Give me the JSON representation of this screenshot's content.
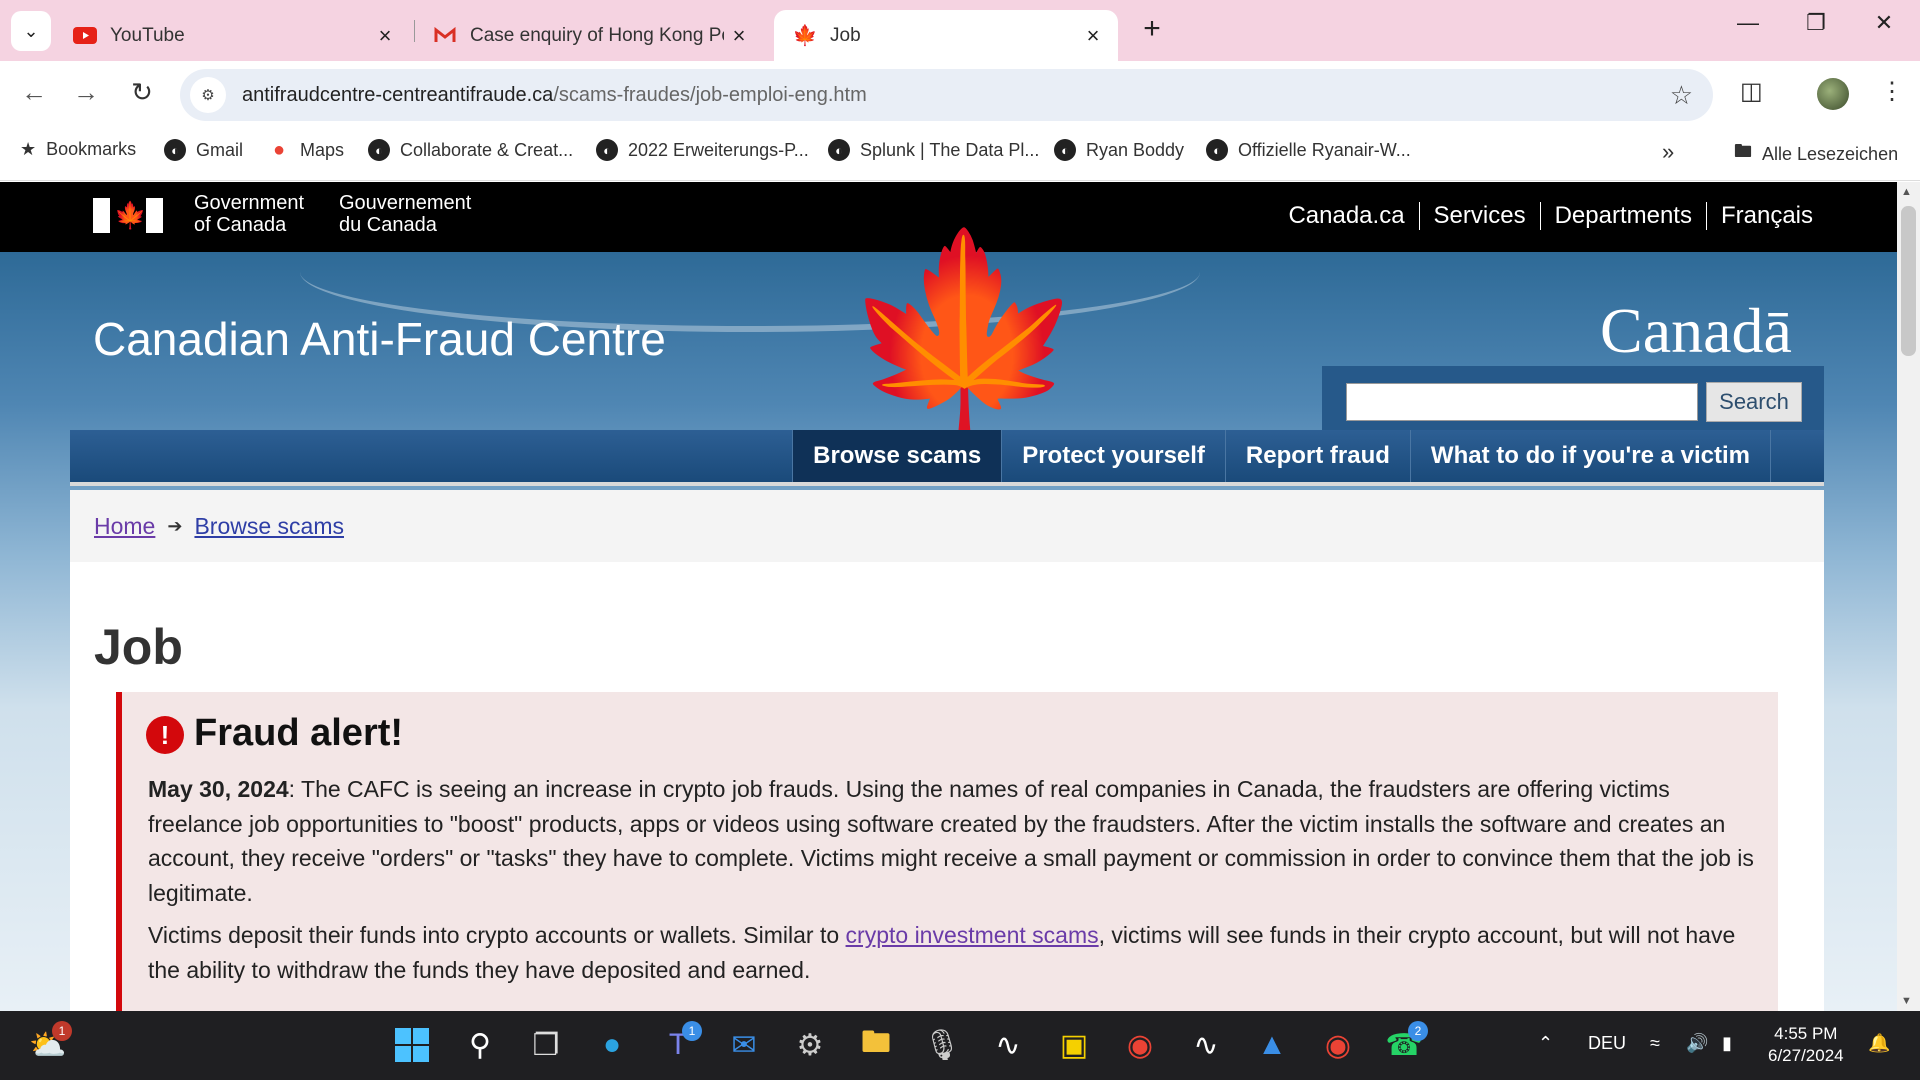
{
  "browser": {
    "tabs": [
      {
        "label": "YouTube",
        "icon": "youtube-icon"
      },
      {
        "label": "Case enquiry of Hong Kong Pol",
        "icon": "gmail-icon"
      },
      {
        "label": "Job",
        "icon": "maple-leaf-icon",
        "active": true
      }
    ],
    "address": {
      "domain": "antifraudcentre-centreantifraude.ca",
      "path": "/scams-fraudes/job-emploi-eng.htm"
    },
    "bookmarks": [
      "Bookmarks",
      "Gmail",
      "Maps",
      "Collaborate & Creat...",
      "2022 Erweiterungs-P...",
      "Splunk | The Data Pl...",
      "Ryan Boddy",
      "Offizielle Ryanair-W..."
    ],
    "all_bookmarks": "Alle Lesezeichen"
  },
  "page": {
    "goc": {
      "en_line1": "Government",
      "en_line2": "of Canada",
      "fr_line1": "Gouvernement",
      "fr_line2": "du Canada"
    },
    "goc_nav": [
      "Canada.ca",
      "Services",
      "Departments",
      "Français"
    ],
    "site_title": "Canadian Anti-Fraud Centre",
    "wordmark": "Canadā",
    "search_button": "Search",
    "main_nav": [
      "Browse scams",
      "Protect yourself",
      "Report fraud",
      "What to do if you're a victim"
    ],
    "breadcrumb": [
      "Home",
      "Browse scams"
    ],
    "title": "Job",
    "alert": {
      "heading": "Fraud alert!",
      "date": "May 30, 2024",
      "p1": ": The CAFC is seeing an increase in crypto job frauds. Using the names of real companies in Canada, the fraudsters are offering victims freelance job opportunities to \"boost\" products, apps or videos using software created by the fraudsters. After the victim installs the software and creates an account, they receive \"orders\" or \"tasks\" they have to complete. Victims might receive a small payment or commission in order to convince them that the job is legitimate.",
      "p2_before": "Victims deposit their funds into crypto accounts or wallets. Similar to ",
      "p2_link": "crypto investment scams",
      "p2_after": ", victims will see funds in their crypto account, but will not have the ability to withdraw the funds they have deposited and earned."
    }
  },
  "taskbar": {
    "language": "DEU",
    "time": "4:55 PM",
    "date": "6/27/2024",
    "badges": {
      "weather": "1",
      "teams": "1",
      "whatsapp": "2"
    }
  }
}
